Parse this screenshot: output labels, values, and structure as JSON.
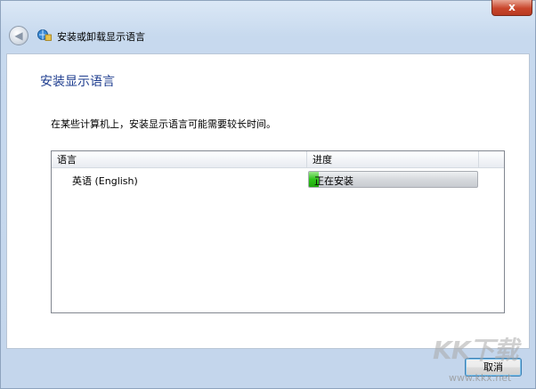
{
  "window": {
    "close_glyph": "x",
    "title": "安装或卸载显示语言",
    "back_icon": "back-arrow-icon",
    "app_icon": "language-icon"
  },
  "page": {
    "heading": "安装显示语言",
    "description": "在某些计算机上，安装显示语言可能需要较长时间。"
  },
  "list": {
    "columns": [
      "语言",
      "进度"
    ],
    "rows": [
      {
        "language": "英语 (English)",
        "status": "正在安装",
        "progress": 0.06
      }
    ]
  },
  "buttons": {
    "cancel": "取消"
  },
  "watermark": {
    "logo": "KK下载",
    "url": "www.kkx.net"
  },
  "colors": {
    "heading": "#1e3d8f",
    "progress_fill": "#2fc41a",
    "close_button": "#c9462c"
  }
}
